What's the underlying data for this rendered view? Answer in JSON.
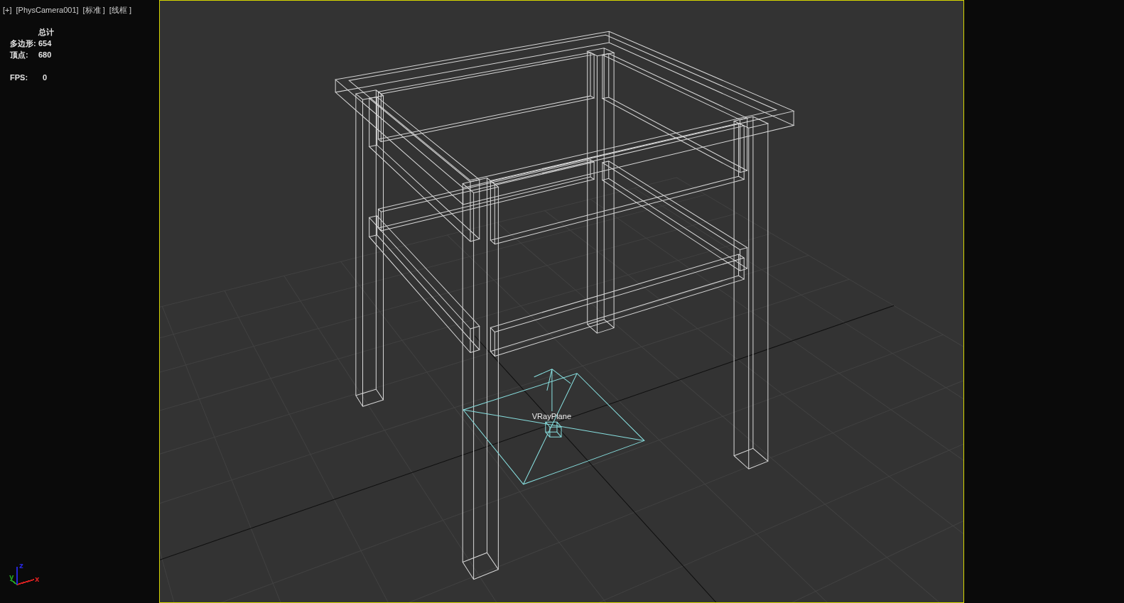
{
  "viewport_labels": [
    "[+]",
    "[PhysCamera001]",
    "[标准 ]",
    "[线框 ]"
  ],
  "stats": {
    "header": "总计",
    "rows": [
      {
        "label": "多边形:",
        "value": "654"
      },
      {
        "label": "顶点:",
        "value": "680"
      }
    ],
    "fps": {
      "label": "FPS:",
      "value": "0"
    }
  },
  "viewport": {
    "active": true,
    "objects": [
      {
        "kind": "table"
      },
      {
        "kind": "plane_light",
        "label": "VRayPlane"
      }
    ]
  },
  "axis_gizmo": {
    "axes": [
      {
        "label": "x",
        "color": "#d42020"
      },
      {
        "label": "y",
        "color": "#22a022"
      },
      {
        "label": "z",
        "color": "#2626d8"
      }
    ]
  }
}
